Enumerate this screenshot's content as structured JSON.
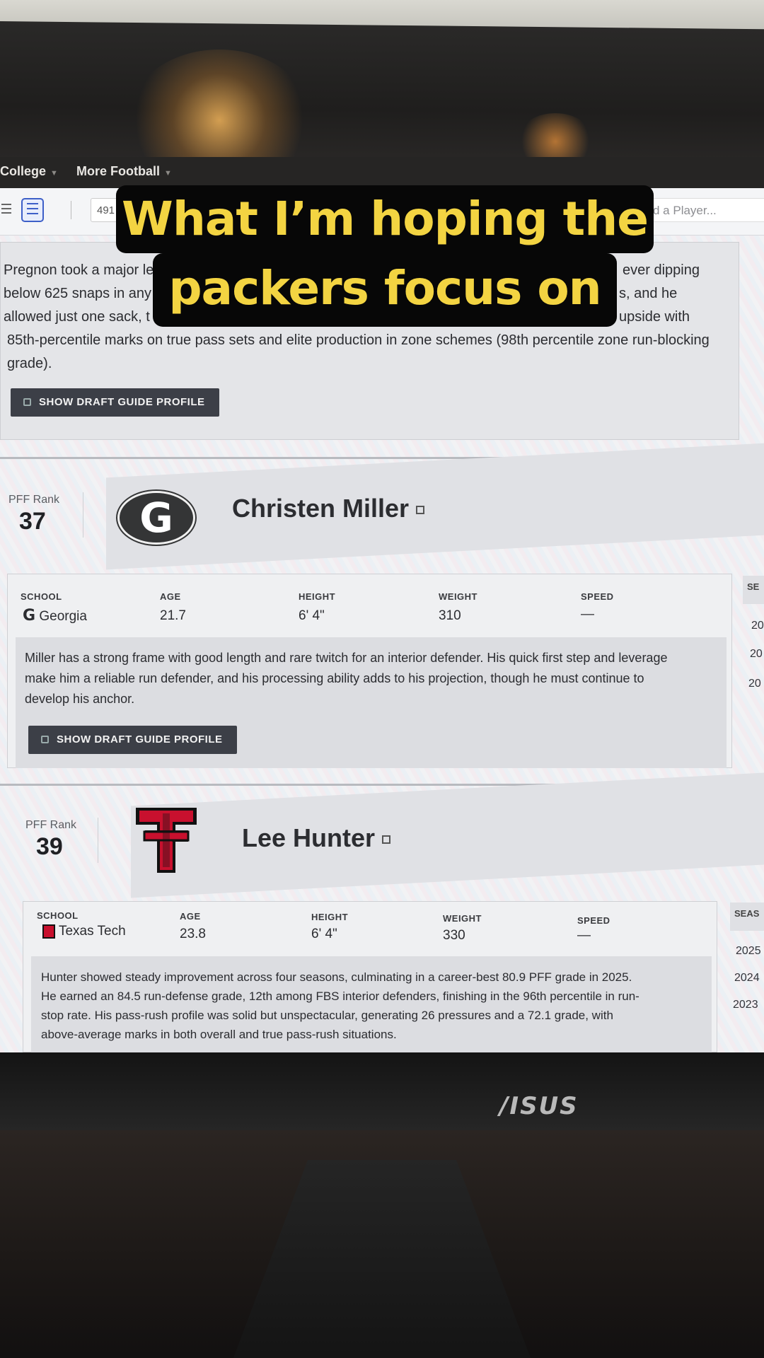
{
  "caption": {
    "line1": "What I’m hoping the",
    "line2": "packers focus on"
  },
  "monitor_brand": "/ISUS",
  "site_nav": {
    "items": [
      "College",
      "More Football"
    ]
  },
  "toolbar": {
    "page_field_value": "491",
    "search_placeholder": "d a Player..."
  },
  "previous_player": {
    "summary_fragments": [
      "Pregnon took a major le",
      "ever dipping",
      "below 625 snaps in any",
      "s, and he",
      "allowed just one sack, t",
      "upside with",
      "85th-percentile marks on true pass sets and elite production in zone schemes (98th percentile zone run-blocking",
      "grade)."
    ],
    "button": "SHOW DRAFT GUIDE PROFILE"
  },
  "players": [
    {
      "rank_label": "PFF Rank",
      "rank": "37",
      "name": "Christen Miller",
      "logo_icon": "georgia-g-logo",
      "columns": {
        "school": "SCHOOL",
        "age": "AGE",
        "height": "HEIGHT",
        "weight": "WEIGHT",
        "speed": "SPEED"
      },
      "school": "Georgia",
      "age": "21.7",
      "height": "6' 4\"",
      "weight": "310",
      "speed": "—",
      "description": [
        "Miller has a strong frame with good length and rare twitch for an interior defender. His quick first step and leverage",
        "make him a reliable run defender, and his processing ability adds to his projection, though he must continue to",
        "develop his anchor."
      ],
      "button": "SHOW DRAFT GUIDE PROFILE",
      "side_header": "SE",
      "side_years": [
        "20",
        "20",
        "20"
      ]
    },
    {
      "rank_label": "PFF Rank",
      "rank": "39",
      "name": "Lee Hunter",
      "logo_icon": "texas-tech-double-t-logo",
      "columns": {
        "school": "SCHOOL",
        "age": "AGE",
        "height": "HEIGHT",
        "weight": "WEIGHT",
        "speed": "SPEED"
      },
      "school": "Texas Tech",
      "age": "23.8",
      "height": "6' 4\"",
      "weight": "330",
      "speed": "—",
      "description": [
        "Hunter showed steady improvement across four seasons, culminating in a career-best 80.9 PFF grade in 2025.",
        "He earned an 84.5 run-defense grade, 12th among FBS interior defenders, finishing in the 96th percentile in run-",
        "stop rate. His pass-rush profile was solid but unspectacular, generating 26 pressures and a 72.1 grade, with",
        "above-average marks in both overall and true pass-rush situations."
      ],
      "side_header": "SEAS",
      "side_years": [
        "2025",
        "2024",
        "2023"
      ]
    }
  ],
  "colors": {
    "caption_text": "#f3d442",
    "caption_bg": "#070707",
    "texas_tech_red": "#c8102e",
    "georgia_dark": "#343536",
    "button_bg": "#3c3f47"
  }
}
